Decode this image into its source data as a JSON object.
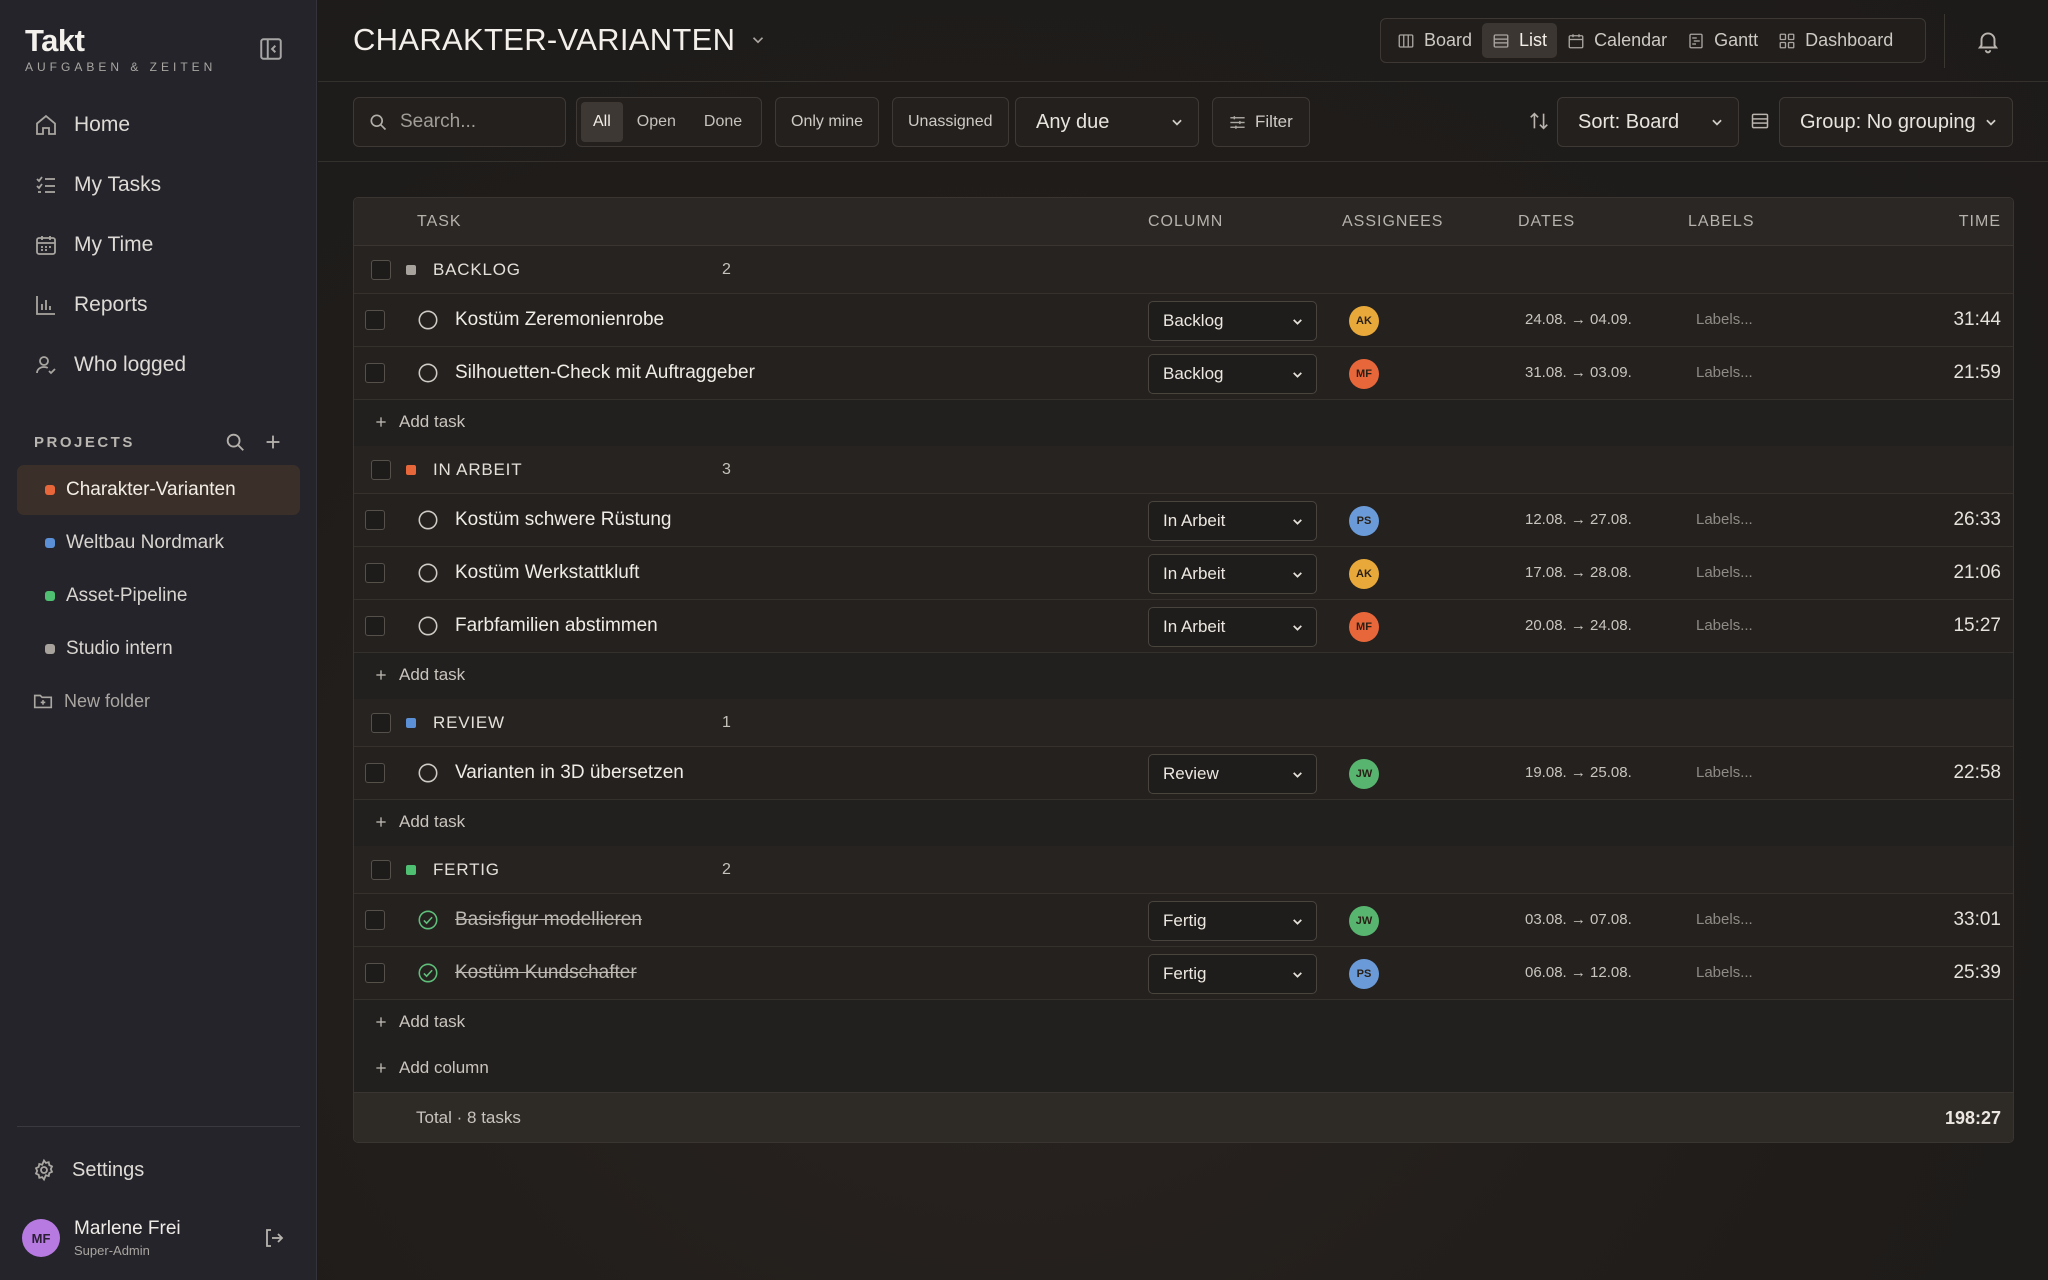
{
  "brand": {
    "name": "Takt",
    "subtitle": "AUFGABEN & ZEITEN"
  },
  "nav": [
    {
      "label": "Home",
      "icon": "home-icon"
    },
    {
      "label": "My Tasks",
      "icon": "checklist-icon"
    },
    {
      "label": "My Time",
      "icon": "calendar-icon"
    },
    {
      "label": "Reports",
      "icon": "bar-chart-icon"
    },
    {
      "label": "Who logged",
      "icon": "user-check-icon"
    }
  ],
  "projects": {
    "title": "PROJECTS",
    "items": [
      {
        "label": "Charakter-Varianten",
        "color": "#e8673a",
        "active": true
      },
      {
        "label": "Weltbau Nordmark",
        "color": "#5b8fd6"
      },
      {
        "label": "Asset-Pipeline",
        "color": "#4fbf72"
      },
      {
        "label": "Studio intern",
        "color": "#a8a29c"
      }
    ],
    "new_folder": "New folder"
  },
  "settings_label": "Settings",
  "user": {
    "name": "Marlene Frei",
    "role": "Super-Admin",
    "initials": "MF"
  },
  "page": {
    "title": "CHARAKTER-VARIANTEN"
  },
  "views": [
    {
      "label": "Board",
      "icon": "board-icon"
    },
    {
      "label": "List",
      "icon": "list-icon",
      "active": true
    },
    {
      "label": "Calendar",
      "icon": "calendar-icon"
    },
    {
      "label": "Gantt",
      "icon": "gantt-icon"
    },
    {
      "label": "Dashboard",
      "icon": "dashboard-icon"
    }
  ],
  "toolbar": {
    "search_placeholder": "Search...",
    "segments": [
      "All",
      "Open",
      "Done"
    ],
    "only_mine": "Only mine",
    "unassigned": "Unassigned",
    "due": "Any due",
    "filter": "Filter",
    "sort": "Sort: Board",
    "group": "Group: No grouping"
  },
  "table": {
    "headers": {
      "task": "TASK",
      "column": "COLUMN",
      "assignees": "ASSIGNEES",
      "dates": "DATES",
      "labels": "LABELS",
      "time": "TIME"
    },
    "add_task": "Add task",
    "add_column": "Add column",
    "groups": [
      {
        "name": "BACKLOG",
        "color": "#a8a29c",
        "count": "2",
        "tasks": [
          {
            "name": "Kostüm Zeremonienrobe",
            "column": "Backlog",
            "assignee": "AK",
            "avatar_color": "#e8a93a",
            "dates": "24.08. → 04.09.",
            "labels": "Labels...",
            "time": "31:44",
            "done": false
          },
          {
            "name": "Silhouetten-Check mit Auftraggeber",
            "column": "Backlog",
            "assignee": "MF",
            "avatar_color": "#e8673a",
            "dates": "31.08. → 03.09.",
            "labels": "Labels...",
            "time": "21:59",
            "done": false
          }
        ]
      },
      {
        "name": "IN ARBEIT",
        "color": "#e8673a",
        "count": "3",
        "tasks": [
          {
            "name": "Kostüm schwere Rüstung",
            "column": "In Arbeit",
            "assignee": "PS",
            "avatar_color": "#6a9bd8",
            "dates": "12.08. → 27.08.",
            "labels": "Labels...",
            "time": "26:33",
            "done": false
          },
          {
            "name": "Kostüm Werkstattkluft",
            "column": "In Arbeit",
            "assignee": "AK",
            "avatar_color": "#e8a93a",
            "dates": "17.08. → 28.08.",
            "labels": "Labels...",
            "time": "21:06",
            "done": false
          },
          {
            "name": "Farbfamilien abstimmen",
            "column": "In Arbeit",
            "assignee": "MF",
            "avatar_color": "#e8673a",
            "dates": "20.08. → 24.08.",
            "labels": "Labels...",
            "time": "15:27",
            "done": false
          }
        ]
      },
      {
        "name": "REVIEW",
        "color": "#5b8fd6",
        "count": "1",
        "tasks": [
          {
            "name": "Varianten in 3D übersetzen",
            "column": "Review",
            "assignee": "JW",
            "avatar_color": "#58b56f",
            "dates": "19.08. → 25.08.",
            "labels": "Labels...",
            "time": "22:58",
            "done": false
          }
        ]
      },
      {
        "name": "FERTIG",
        "color": "#4fbf72",
        "count": "2",
        "tasks": [
          {
            "name": "Basisfigur modellieren",
            "column": "Fertig",
            "assignee": "JW",
            "avatar_color": "#58b56f",
            "dates": "03.08. → 07.08.",
            "labels": "Labels...",
            "time": "33:01",
            "done": true
          },
          {
            "name": "Kostüm Kundschafter",
            "column": "Fertig",
            "assignee": "PS",
            "avatar_color": "#6a9bd8",
            "dates": "06.08. → 12.08.",
            "labels": "Labels...",
            "time": "25:39",
            "done": true
          }
        ]
      }
    ],
    "total_label": "Total · 8 tasks",
    "total_time": "198:27"
  }
}
